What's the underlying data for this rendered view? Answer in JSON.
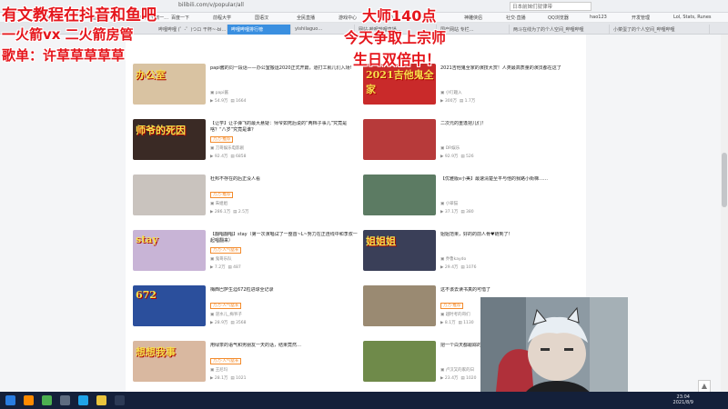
{
  "browser": {
    "url": "bilibili.com/v/popular/all",
    "search_placeholder": "日本前妹们就律带",
    "bookmarks": [
      "百度",
      "天猫",
      "斗鱼",
      "仿制·只为 千旅一…",
      "百度一下",
      "前程大学",
      "国语汉",
      "全民直播",
      "游戏中心",
      "7K.cn",
      "中国人",
      "神雕侠侣",
      "社交·直播",
      "QQ浏览器",
      "hao123",
      "开发管理",
      "Lol, Stats, Runes"
    ],
    "tabs": [
      {
        "label": "哔哩哔哩 (゜-゜)つロ 干杯~-bi…",
        "active": false
      },
      {
        "label": "哔哩哔哩排行榜",
        "active": true
      },
      {
        "label": "yishilaguo…",
        "active": false
      },
      {
        "label": "网站-哔哩哔哩直播…",
        "active": false
      },
      {
        "label": "国产网站 专栏…",
        "active": false
      },
      {
        "label": "两斗在线为了的个人空间_哔哩哔哩",
        "active": false
      },
      {
        "label": "小菜蛋了的个人空间_哔哩哔哩",
        "active": false
      }
    ]
  },
  "overlay": {
    "line1": "有文教程在抖音和鱼吧",
    "line2": "一火箭vx 二火箭房管",
    "line3": "歌单：许草草草草草",
    "right1": "大师140点",
    "right2": "今天争取上宗师",
    "right3": "生日双倍中！"
  },
  "videos": [
    {
      "title": "papi酱的同一段话——办公室搬运2020正式开篇，道打工就几们入场!",
      "tag": "",
      "author": "papi酱",
      "views": "54.9万",
      "comments": "1664",
      "thumb_text": "办公室"
    },
    {
      "title": "2021吉他鬼全家的演技大赏！人类最高质量的演员都在这了",
      "tag": "",
      "author": "小叮趣入",
      "views": "300万",
      "comments": "1.7万",
      "thumb_text": "2021吉他鬼全家"
    },
    {
      "title": "【让学】让子弹飞的最大悬疑：师爷如死后说的“两档子事儿”究竟是啥？“八岁”究竟是谁？",
      "tag": "万万·推荐",
      "author": "刀哥娱乐电影剧",
      "views": "92.4万",
      "comments": "6858",
      "thumb_text": "师爷的死因"
    },
    {
      "title": "二次元的重逢把儿们！",
      "tag": "",
      "author": "DR娱乐",
      "views": "92.9万",
      "comments": "526",
      "thumb_text": ""
    },
    {
      "title": "杜邦不存在的后正没人看",
      "tag": "万万·推荐",
      "author": "朱姐姐",
      "views": "286.1万",
      "comments": "2.5万",
      "thumb_text": ""
    },
    {
      "title": "【优雅版x小美】最速清楚至平与他的我路小街梯……",
      "tag": "",
      "author": "小翠猫",
      "views": "37.1万",
      "comments": "380",
      "thumb_text": ""
    },
    {
      "title": "【翻唱翻唱】stay（第一次演唱试了一整首~L~努力在正连线中和李叔一起唱翻来）",
      "tag": "万万·人气猛长",
      "author": "鬼哥乐队",
      "views": "7.2万",
      "comments": "487",
      "thumb_text": "stay"
    },
    {
      "title": "姐姐范果，好的的前人骨♥链到了!",
      "tag": "",
      "author": "乔鲁kaydo",
      "views": "29.4万",
      "comments": "1076",
      "thumb_text": "姐姐姐"
    },
    {
      "title": "梅西巴萨生涯672粒进球全记录",
      "tag": "万万·人气猛长",
      "author": "逆水儿_梅爷子",
      "views": "28.9万",
      "comments": "3568",
      "thumb_text": "672"
    },
    {
      "title": "这不该去读书真的可惜了",
      "tag": "万万·推荐",
      "author": "越时考的哥们",
      "views": "8.1万",
      "comments": "1130",
      "thumb_text": ""
    },
    {
      "title": "用绿茶的语气和男朋友一天的话，结果竟然…",
      "tag": "万万·人气猛长",
      "author": "王尼玛",
      "views": "28.1万",
      "comments": "1021",
      "thumb_text": "想想我事"
    },
    {
      "title": "把一个白天都跟踪的…",
      "tag": "",
      "author": "卢汉又的家的日",
      "views": "23.4万",
      "comments": "1020",
      "thumb_text": ""
    }
  ],
  "taskbar": {
    "time": "23:04",
    "date": "2021/8/9"
  },
  "colors": {
    "overlay": "#e5161c",
    "accent": "#3a8fe0",
    "tag": "#f38b2c"
  }
}
